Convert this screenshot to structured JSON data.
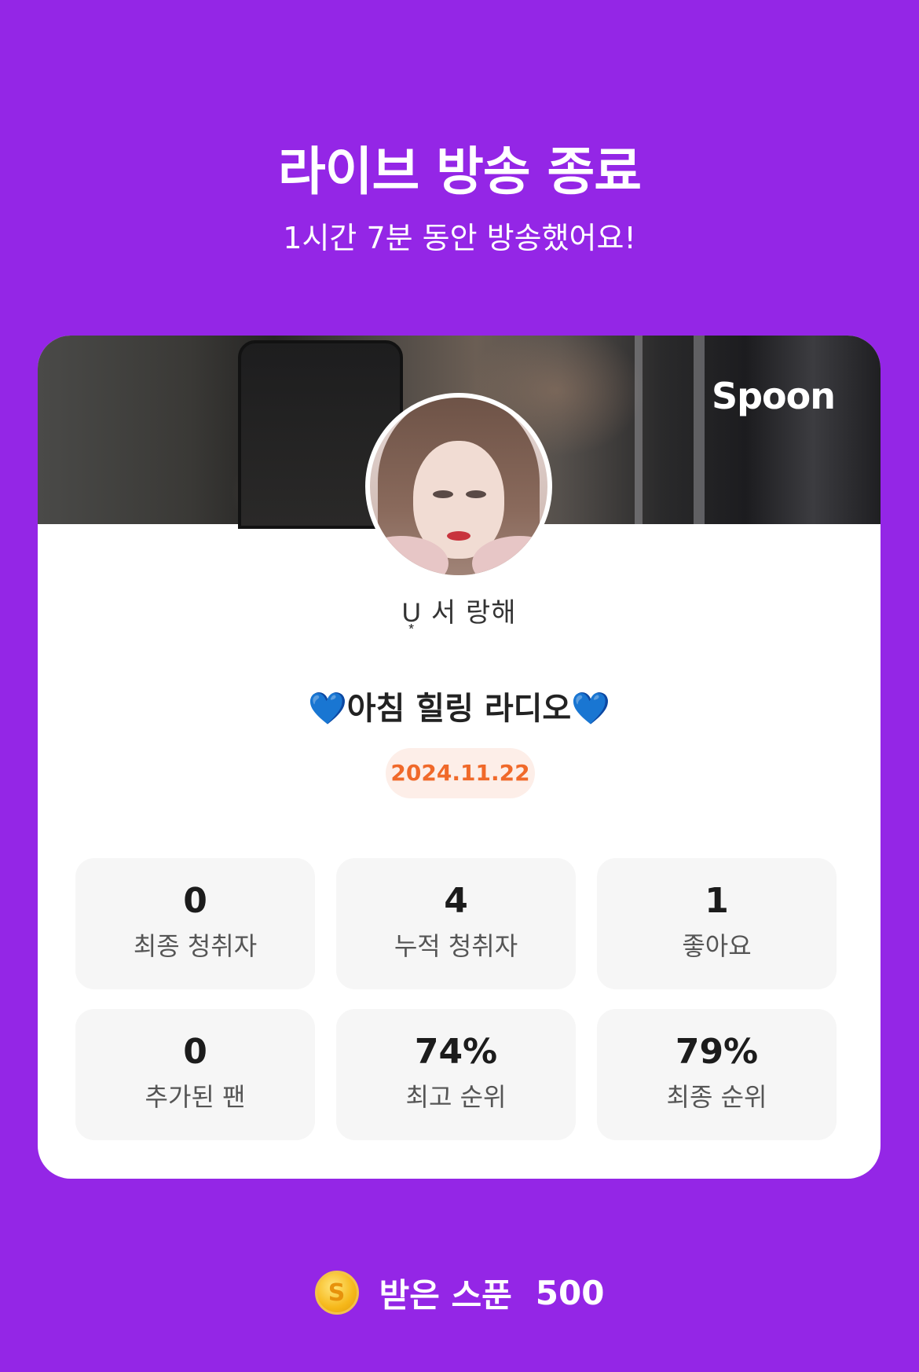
{
  "header": {
    "title": "라이브 방송 종료",
    "subtitle": "1시간 7분 동안 방송했어요!"
  },
  "card": {
    "brand": "Spoon",
    "username": "U͙ 서 랑해",
    "room_title": "💙아침 힐링 라디오💙",
    "date": "2024.11.22",
    "stats": [
      {
        "value": "0",
        "label": "최종 청취자"
      },
      {
        "value": "4",
        "label": "누적 청취자"
      },
      {
        "value": "1",
        "label": "좋아요"
      },
      {
        "value": "0",
        "label": "추가된 팬"
      },
      {
        "value": "74%",
        "label": "최고 순위"
      },
      {
        "value": "79%",
        "label": "최종 순위"
      }
    ]
  },
  "reward": {
    "icon": "spoon-coin-icon",
    "coin_letter": "S",
    "label": "받은 스푼",
    "value": "500"
  },
  "colors": {
    "background": "#9426e6",
    "card": "#ffffff",
    "stat_bg": "#f6f6f6",
    "date_text": "#f0692a",
    "date_bg": "#fdeee8"
  }
}
